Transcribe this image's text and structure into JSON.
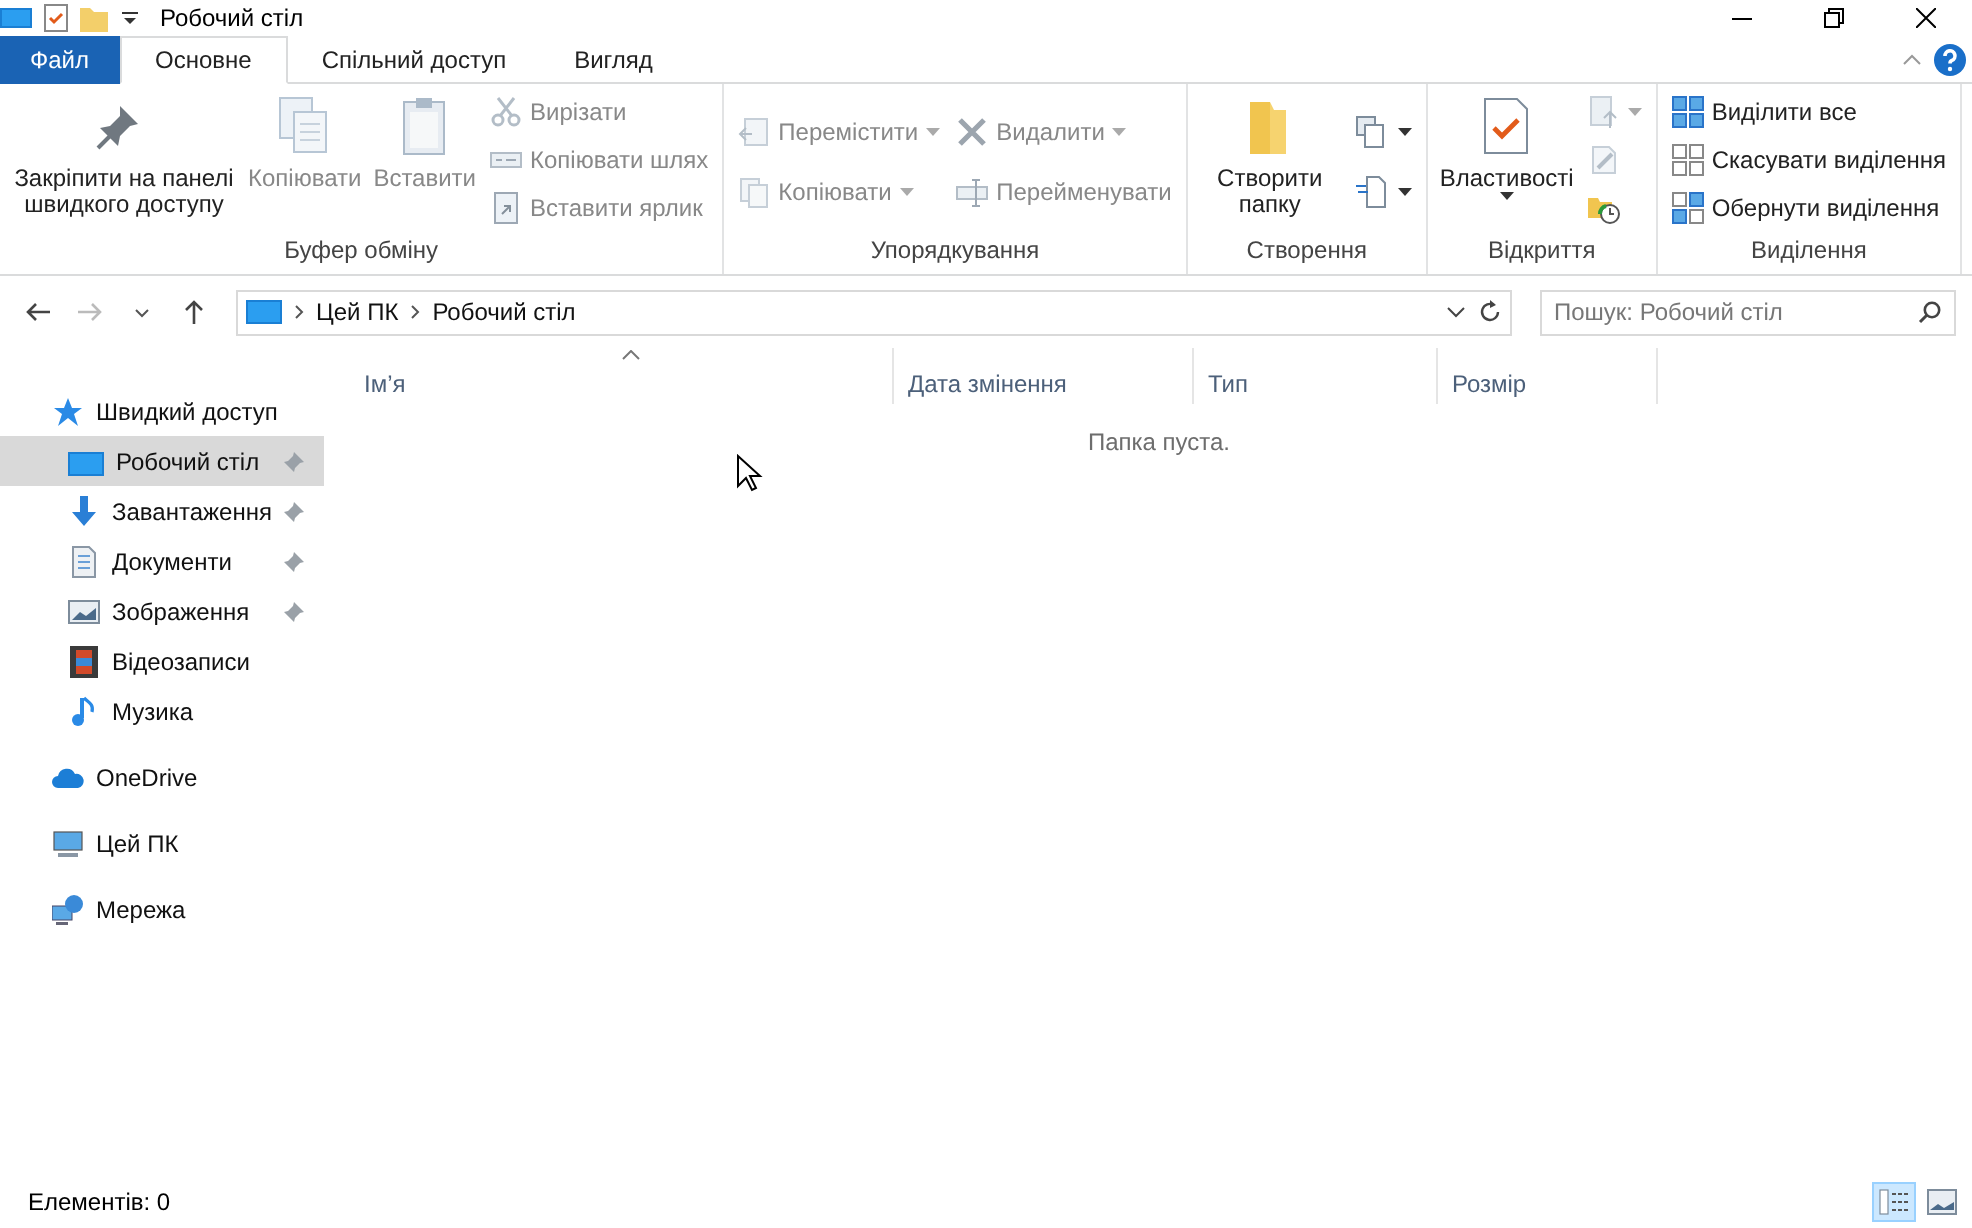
{
  "window": {
    "title": "Робочий стіл"
  },
  "ribbon_tabs": [
    {
      "label": "Файл",
      "kind": "file",
      "selected": false
    },
    {
      "label": "Основне",
      "kind": "tab",
      "selected": true
    },
    {
      "label": "Спільний доступ",
      "kind": "tab",
      "selected": false
    },
    {
      "label": "Вигляд",
      "kind": "tab",
      "selected": false
    }
  ],
  "ribbon_groups": [
    {
      "label": "Буфер обміну",
      "columns": [
        [
          {
            "label": "Закріпити на панелі швидкого доступу",
            "kind": "large",
            "disabled": false,
            "dropdown": false
          }
        ],
        [
          {
            "label": "Копіювати",
            "kind": "large",
            "disabled": true,
            "dropdown": false
          }
        ],
        [
          {
            "label": "Вставити",
            "kind": "large",
            "disabled": true,
            "dropdown": false
          }
        ],
        [
          {
            "label": "Вирізати",
            "kind": "small",
            "disabled": true,
            "dropdown": false
          },
          {
            "label": "Копіювати шлях",
            "kind": "small",
            "disabled": true,
            "dropdown": false
          },
          {
            "label": "Вставити ярлик",
            "kind": "small",
            "disabled": true,
            "dropdown": false
          }
        ]
      ]
    },
    {
      "label": "Упорядкування",
      "columns": [
        [
          {
            "label": "Перемістити",
            "kind": "small",
            "disabled": true,
            "dropdown": true
          },
          {
            "label": "Копіювати",
            "kind": "small",
            "disabled": true,
            "dropdown": true
          }
        ],
        [
          {
            "label": "Видалити",
            "kind": "small",
            "disabled": true,
            "dropdown": true
          },
          {
            "label": "Перейменувати",
            "kind": "small",
            "disabled": true,
            "dropdown": false
          }
        ]
      ]
    },
    {
      "label": "Створення",
      "columns": [
        [
          {
            "label": "Створити папку",
            "kind": "large",
            "disabled": false,
            "dropdown": false
          }
        ],
        [
          {
            "kind": "icon",
            "disabled": false,
            "dropdown": true
          },
          {
            "kind": "icon",
            "disabled": false,
            "dropdown": true
          }
        ]
      ]
    },
    {
      "label": "Відкриття",
      "columns": [
        [
          {
            "label": "Властивості",
            "kind": "large",
            "disabled": false,
            "dropdown": true
          }
        ],
        [
          {
            "kind": "icon",
            "disabled": true,
            "dropdown": true
          },
          {
            "kind": "icon",
            "disabled": true,
            "dropdown": false
          },
          {
            "kind": "icon",
            "disabled": false,
            "dropdown": false
          }
        ]
      ]
    },
    {
      "label": "Виділення",
      "columns": [
        [
          {
            "label": "Виділити все",
            "kind": "small",
            "disabled": false,
            "dropdown": false
          },
          {
            "label": "Скасувати виділення",
            "kind": "small",
            "disabled": false,
            "dropdown": false
          },
          {
            "label": "Обернути виділення",
            "kind": "small",
            "disabled": false,
            "dropdown": false
          }
        ]
      ]
    }
  ],
  "address": {
    "crumbs": [
      "Цей ПК",
      "Робочий стіл"
    ]
  },
  "search": {
    "placeholder": "Пошук: Робочий стіл"
  },
  "sidebar": [
    {
      "label": "Швидкий доступ",
      "selected": false,
      "children": [
        {
          "label": "Робочий стіл",
          "pinned": true,
          "selected": true
        },
        {
          "label": "Завантаження",
          "pinned": true,
          "selected": false
        },
        {
          "label": "Документи",
          "pinned": true,
          "selected": false
        },
        {
          "label": "Зображення",
          "pinned": true,
          "selected": false
        },
        {
          "label": "Відеозаписи",
          "pinned": false,
          "selected": false
        },
        {
          "label": "Музика",
          "pinned": false,
          "selected": false
        }
      ]
    },
    {
      "label": "OneDrive",
      "selected": false
    },
    {
      "label": "Цей ПК",
      "selected": false
    },
    {
      "label": "Мережа",
      "selected": false
    }
  ],
  "columns": [
    {
      "label": "Ім’я",
      "sorted": true
    },
    {
      "label": "Дата змінення",
      "sorted": false
    },
    {
      "label": "Тип",
      "sorted": false
    },
    {
      "label": "Розмір",
      "sorted": false
    }
  ],
  "empty_message": "Папка пуста.",
  "status_bar": {
    "text": "Елементів: 0",
    "views": [
      {
        "selected": true
      },
      {
        "selected": false
      }
    ]
  }
}
